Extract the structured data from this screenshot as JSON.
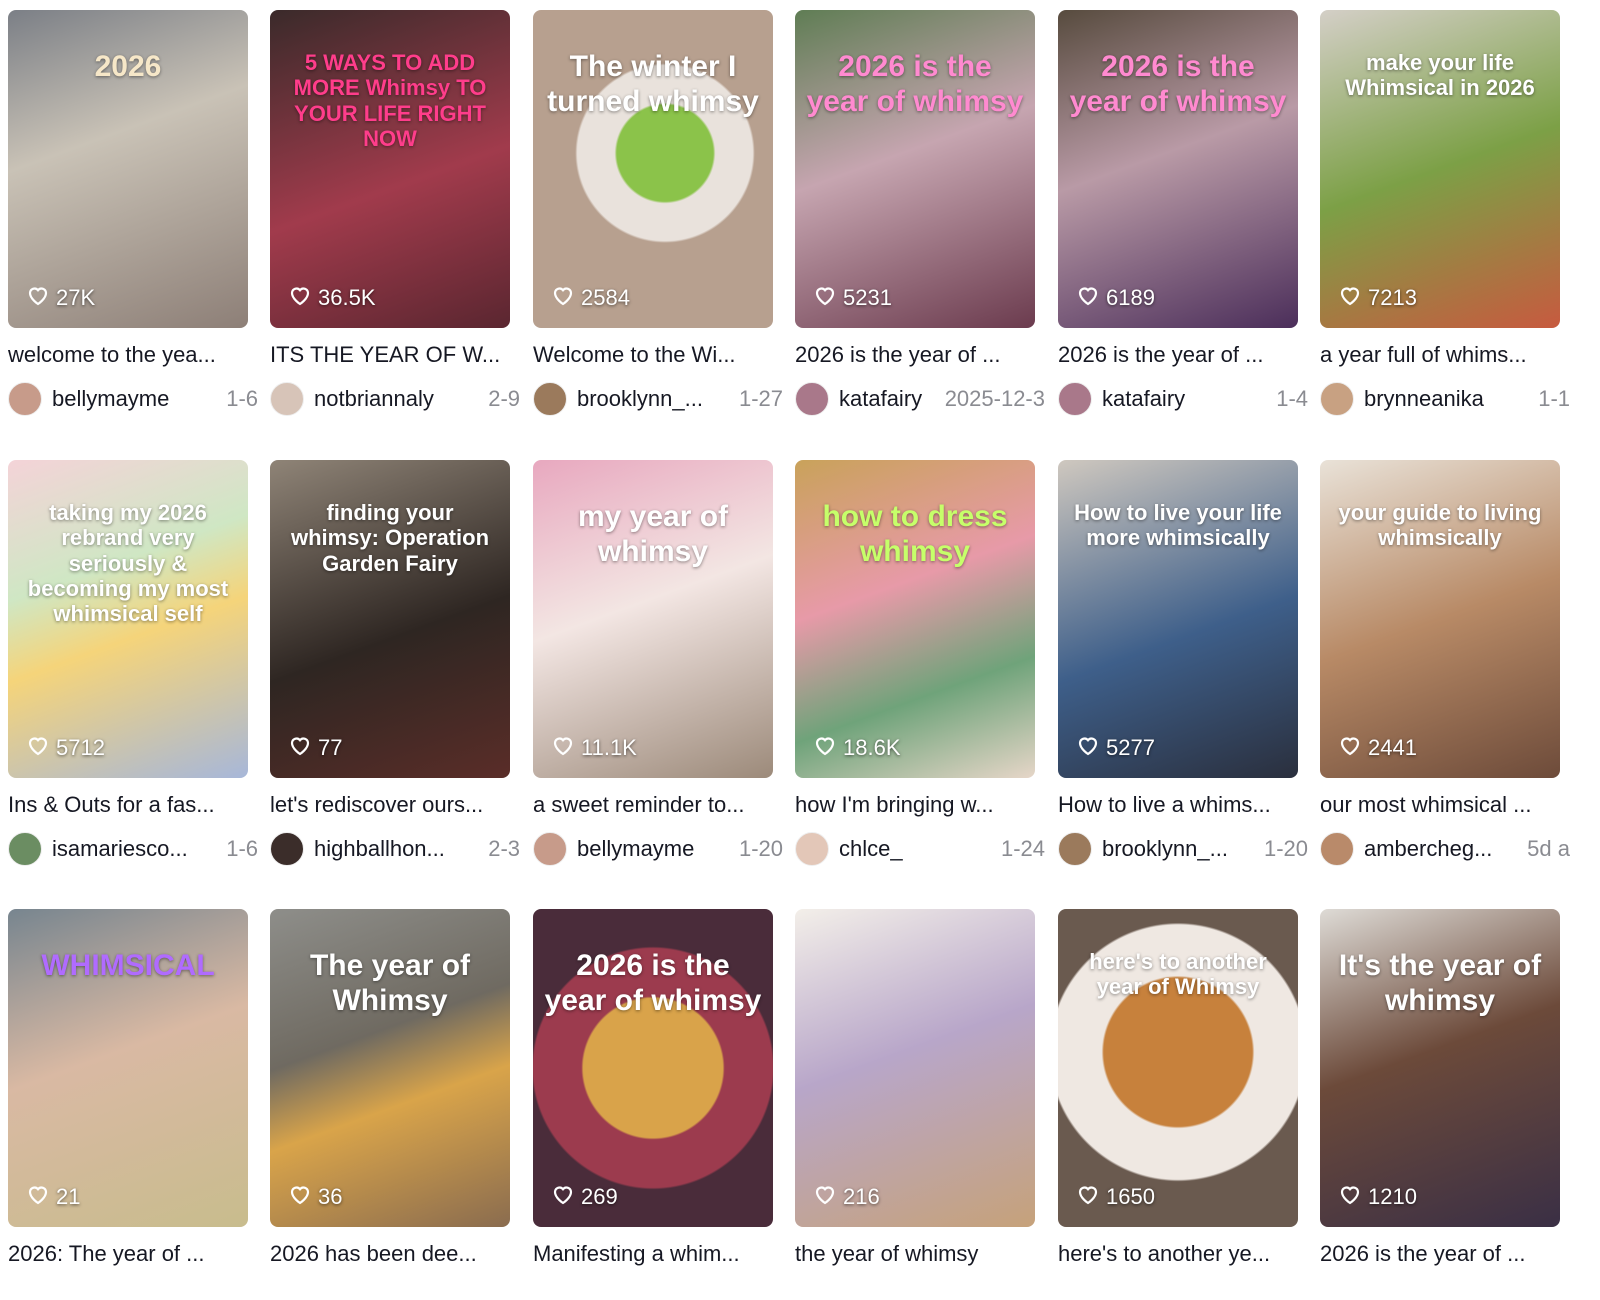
{
  "videos": [
    {
      "caption": "welcome to the yea...",
      "user": "bellymayme",
      "date": "1-6",
      "likes": "27K",
      "overlay": "2026",
      "bg": "linear-gradient(160deg,#7b7f86,#c9c2b6 40%,#8d7f77)",
      "avatar": "#c79b8a",
      "overlayColor": "#f6e7c8"
    },
    {
      "caption": "ITS THE YEAR OF W...",
      "user": "notbriannaly",
      "date": "2-9",
      "likes": "36.5K",
      "overlay": "5 WAYS TO ADD MORE Whimsy TO YOUR LIFE RIGHT NOW",
      "bg": "linear-gradient(160deg,#3a2a2a,#a13b4c 55%,#5a2630)",
      "avatar": "#d7c4b8",
      "overlayColor": "#ff3d8b"
    },
    {
      "caption": "Welcome to the Wi...",
      "user": "brooklynn_...",
      "date": "1-27",
      "likes": "2584",
      "overlay": "The winter I turned whimsy",
      "bg": "radial-gradient(circle at 55% 45%,#8bc34a 0 22%,#e9e2dc 23% 40%,#b7a08f 41%)",
      "avatar": "#9b7a5c",
      "overlayColor": "#ffffff"
    },
    {
      "caption": "2026 is the year of ...",
      "user": "katafairy",
      "date": "2025-12-3",
      "likes": "5231",
      "overlay": "2026 is the year of whimsy",
      "bg": "linear-gradient(160deg,#5f7d54,#c6a5b0 45%,#6b3b4e)",
      "avatar": "#a9788a",
      "overlayColor": "#ff8ad0"
    },
    {
      "caption": "2026 is the year of ...",
      "user": "katafairy",
      "date": "1-4",
      "likes": "6189",
      "overlay": "2026 is the year of whimsy",
      "bg": "linear-gradient(160deg,#574b3e,#b99aa6 45%,#4b2e5a)",
      "avatar": "#a9788a",
      "overlayColor": "#ff8ad0"
    },
    {
      "caption": "a year full of whims...",
      "user": "brynneanika",
      "date": "1-1",
      "likes": "7213",
      "overlay": "make your life Whimsical in 2026",
      "bg": "linear-gradient(160deg,#d4cfc7,#7ca046 50%,#c75a3f)",
      "avatar": "#c8a182",
      "overlayColor": "#ffffff"
    },
    {
      "caption": "Ins & Outs for a fas...",
      "user": "isamariesco...",
      "date": "1-6",
      "likes": "5712",
      "overlay": "taking my 2026 rebrand very seriously & becoming my most whimsical self",
      "bg": "linear-gradient(160deg,#f4d3d8,#cfe7c4 35%,#f5d47a 55%,#a7b7d9)",
      "avatar": "#6b8d62",
      "overlayColor": "#ffffff"
    },
    {
      "caption": "let's rediscover ours...",
      "user": "highballhon...",
      "date": "2-3",
      "likes": "77",
      "overlay": "finding your whimsy: Operation Garden Fairy",
      "bg": "linear-gradient(160deg,#8f8477,#2e2622 55%,#5a2d28)",
      "avatar": "#3b2d2a",
      "overlayColor": "#ffffff"
    },
    {
      "caption": "a sweet reminder to...",
      "user": "bellymayme",
      "date": "1-20",
      "likes": "11.1K",
      "overlay": "my year of whimsy",
      "bg": "linear-gradient(160deg,#e8a8bf,#f3e6e3 45%,#9c8a7a)",
      "avatar": "#c79b8a",
      "overlayColor": "#ffffff"
    },
    {
      "caption": "how I'm bringing w...",
      "user": "chlce_",
      "date": "1-24",
      "likes": "18.6K",
      "overlay": "how to dress whimsy",
      "bg": "linear-gradient(160deg,#c9a25a,#e79aa8 40%,#6fa37a 70%,#e6d6c8)",
      "avatar": "#e3c7b8",
      "overlayColor": "#c6ff6a"
    },
    {
      "caption": "How to live a whims...",
      "user": "brooklynn_...",
      "date": "1-20",
      "likes": "5277",
      "overlay": "How to live your life more whimsically",
      "bg": "linear-gradient(160deg,#cfc8bf,#3e5f8a 55%,#2a2f3d)",
      "avatar": "#9b7a5c",
      "overlayColor": "#ffffff"
    },
    {
      "caption": "our most whimsical ...",
      "user": "ambercheg...",
      "date": "5d a",
      "likes": "2441",
      "overlay": "your guide to living whimsically",
      "bg": "linear-gradient(160deg,#e9e2d8,#b88a66 50%,#6d4b3a)",
      "avatar": "#b98a6a",
      "overlayColor": "#ffffff"
    },
    {
      "caption": "2026: The year of ...",
      "user": "",
      "date": "",
      "likes": "21",
      "overlay": "WHIMSICAL",
      "bg": "linear-gradient(160deg,#77858f,#d9b9a3 45%,#c8bc8d)",
      "avatar": "",
      "overlayColor": "#b06bff"
    },
    {
      "caption": "2026 has been dee...",
      "user": "",
      "date": "",
      "likes": "36",
      "overlay": "The year of Whimsy",
      "bg": "linear-gradient(160deg,#8e8e8a,#6f6a61 40%,#d9a44a 60%,#8a6c4f)",
      "avatar": "",
      "overlayColor": "#ffffff"
    },
    {
      "caption": "Manifesting a whim...",
      "user": "",
      "date": "",
      "likes": "269",
      "overlay": "2026 is the year of whimsy",
      "bg": "radial-gradient(circle at 50% 50%,#d9a34a 0 35%,#9c3b4e 36% 60%,#4a2c3a 61%)",
      "avatar": "",
      "overlayColor": "#ffffff"
    },
    {
      "caption": "the year of whimsy",
      "user": "",
      "date": "",
      "likes": "216",
      "overlay": "",
      "bg": "linear-gradient(160deg,#f3efe9,#b8a6c9 45%,#c6a27a)",
      "avatar": "",
      "overlayColor": "#ffffff"
    },
    {
      "caption": "here's to another ye...",
      "user": "",
      "date": "",
      "likes": "1650",
      "overlay": "here's to another year of Whimsy",
      "bg": "radial-gradient(circle at 50% 45%,#c7813c 0 35%,#efe8e2 36% 60%,#6a5a4f 61%)",
      "avatar": "",
      "overlayColor": "#ffffff"
    },
    {
      "caption": "2026 is the year of ...",
      "user": "",
      "date": "",
      "likes": "1210",
      "overlay": "It's the year of whimsy",
      "bg": "linear-gradient(160deg,#dedbd6,#6c4a3a 45%,#3a2f45)",
      "avatar": "",
      "overlayColor": "#ffffff"
    }
  ]
}
